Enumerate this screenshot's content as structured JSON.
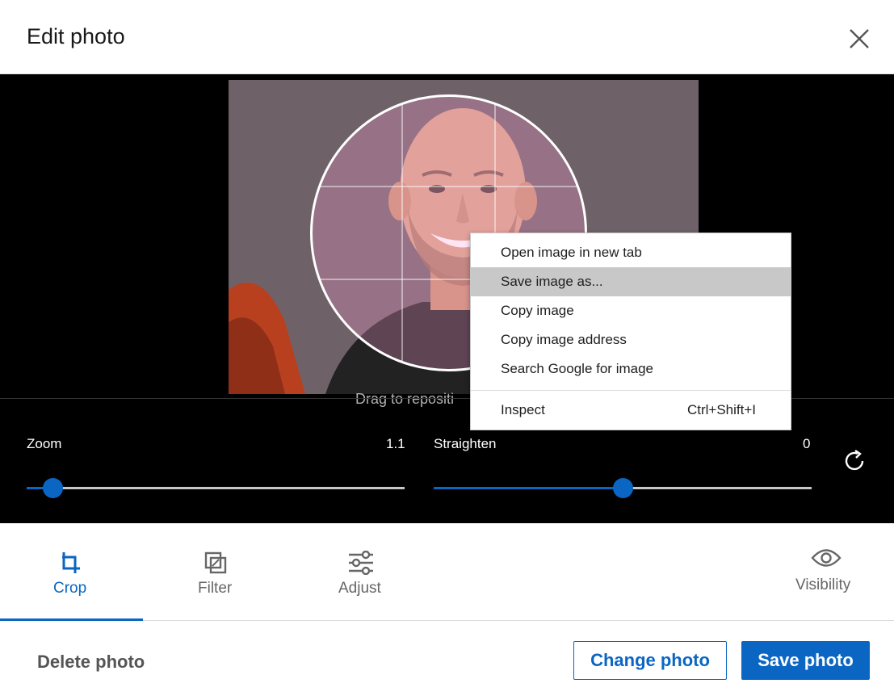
{
  "dialog": {
    "title": "Edit photo"
  },
  "stage": {
    "drag_hint": "Drag to repositi"
  },
  "zoom": {
    "label": "Zoom",
    "value": "1.1",
    "fraction": 0.07
  },
  "straighten": {
    "label": "Straighten",
    "value": "0",
    "fraction": 0.5
  },
  "tabs": [
    {
      "label": "Crop",
      "icon": "crop-icon",
      "active": true
    },
    {
      "label": "Filter",
      "icon": "filter-icon",
      "active": false
    },
    {
      "label": "Adjust",
      "icon": "adjust-icon",
      "active": false
    },
    {
      "label": "Visibility",
      "icon": "eye-icon",
      "active": false
    }
  ],
  "footer": {
    "delete_label": "Delete photo",
    "change_label": "Change photo",
    "save_label": "Save photo"
  },
  "context_menu": {
    "items": [
      {
        "label": "Open image in new tab"
      },
      {
        "label": "Save image as..."
      },
      {
        "label": "Copy image"
      },
      {
        "label": "Copy image address"
      },
      {
        "label": "Search Google for image"
      }
    ],
    "inspect_label": "Inspect",
    "inspect_shortcut": "Ctrl+Shift+I"
  },
  "colors": {
    "accent": "#0a66c2",
    "stage_bg": "#000000",
    "menu_hover": "#c8c8c8"
  }
}
